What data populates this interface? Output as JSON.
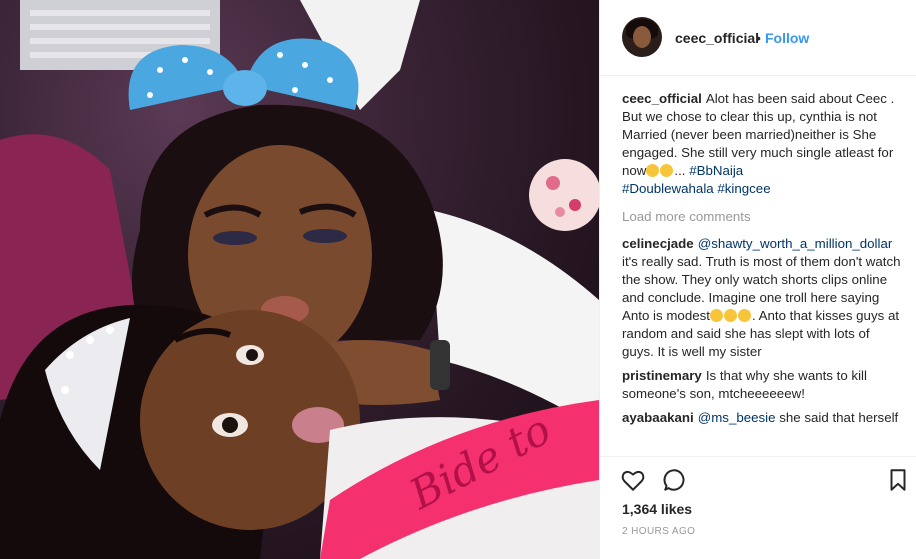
{
  "header": {
    "username": "ceec_official",
    "separator": "•",
    "follow_label": "Follow"
  },
  "caption": {
    "user": "ceec_official",
    "text": "Alot has been said about Ceec . But we chose to clear this up, cynthia is not Married (never been married)neither is She engaged. She still very much single atleast for now",
    "ellipsis": "...",
    "hashtag_1": "#BbNaija",
    "hashtag_2": "#Doublewahala",
    "hashtag_3": "#kingcee"
  },
  "load_more_label": "Load more comments",
  "comments": [
    {
      "user": "celinecjade",
      "mention": "@shawty_worth_a_million_dollar",
      "text_1": "it's really sad. Truth is most of them don't watch the show. They only watch shorts clips online and conclude. Imagine one troll here saying Anto is modest",
      "text_2": ". Anto that kisses guys at random and said she has slept with lots of guys. It is well my sister"
    },
    {
      "user": "pristinemary",
      "text": "Is that why she wants to kill someone's son, mtcheeeeeew!"
    },
    {
      "user": "ayabaakani",
      "mention": "@ms_beesie",
      "text": "she said that herself"
    }
  ],
  "likes": "1,364 likes",
  "timestamp": "2 HOURS AGO",
  "photo": {
    "sash_text": "Bide to"
  },
  "colors": {
    "link": "#003569",
    "follow": "#3897f0",
    "muted": "#999999",
    "sash": "#f5306f",
    "ears": "#4aa7e0"
  }
}
